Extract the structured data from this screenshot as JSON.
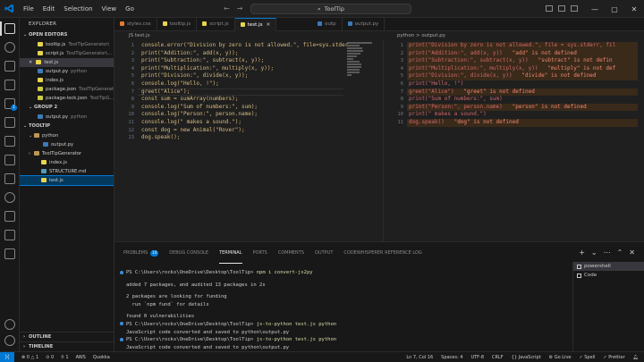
{
  "titlebar": {
    "menu": [
      "File",
      "Edit",
      "Selection",
      "View",
      "Go"
    ],
    "search_text": "ToolTip",
    "colors": {
      "accent": "#0078d4"
    }
  },
  "sidebar": {
    "title": "EXPLORER",
    "open_editors_label": "OPEN EDITORS",
    "open_editors": [
      {
        "name": "tooltip.js",
        "path": "ToolTipGenerator\\",
        "icon": "js"
      },
      {
        "name": "script.js",
        "path": "ToolTipGenerator\\...",
        "icon": "js"
      },
      {
        "name": "test.js",
        "path": "",
        "icon": "js",
        "close": "✕"
      },
      {
        "name": "output.py",
        "path": "python",
        "icon": "py"
      },
      {
        "name": "index.js",
        "path": "",
        "icon": "js"
      },
      {
        "name": "package.json",
        "path": "ToolTipGenerat...",
        "icon": "json"
      },
      {
        "name": "package-lock.json",
        "path": "ToolTipG...",
        "icon": "json"
      }
    ],
    "group2_label": "GROUP 2",
    "group2_items": [
      {
        "name": "output.py",
        "path": "python",
        "icon": "py"
      }
    ],
    "folder_label": "TOOLTIP",
    "tree": [
      {
        "name": "python",
        "icon": "folder",
        "chev": "⌄",
        "indent": 10
      },
      {
        "name": "output.py",
        "icon": "py",
        "chev": "",
        "indent": 20
      },
      {
        "name": "ToolTipGenerator",
        "icon": "folder",
        "chev": "›",
        "indent": 10
      },
      {
        "name": "index.js",
        "icon": "js",
        "chev": "",
        "indent": 18
      },
      {
        "name": "STRUCTURE.md",
        "icon": "md",
        "chev": "",
        "indent": 18
      },
      {
        "name": "test.js",
        "icon": "js",
        "chev": "",
        "indent": 18
      }
    ],
    "outline_label": "OUTLINE",
    "timeline_label": "TIMELINE"
  },
  "tabs": [
    {
      "name": "styles.css",
      "icon": "html"
    },
    {
      "name": "tooltip.js",
      "icon": "js"
    },
    {
      "name": "script.js",
      "icon": "js"
    },
    {
      "name": "test.js",
      "icon": "js",
      "active": true,
      "close": "✕"
    },
    {
      "name": "outp",
      "icon": "py"
    },
    {
      "name": "output.py",
      "icon": "py"
    }
  ],
  "left_editor": {
    "breadcrumb": "JS test.js",
    "lines": [
      "console.error(\"Division by zero is not allowed.\", file=sys.stder",
      "print(\"Addition:\", add(x, y));",
      "print(\"Subtraction:\", subtract(x, y));",
      "print(\"Multiplication:\", multiply(x, y));",
      "print(\"Division:\", divide(x, y));",
      "console.log(\"Hello, !\");",
      "greet(\"Alice\");",
      "const sum = sumArray(numbers);",
      "console.log(\"Sum of numbers:\", sum);",
      "console.log(\"Person:\", person.name);",
      "console.log(\" makes a sound.\");",
      "const dog = new Animal(\"Rover\");",
      "dog.speak();"
    ]
  },
  "right_editor": {
    "breadcrumb": "python > output.py",
    "lines": [
      {
        "code": "print(\"Division by zero is not allowed.\", file = sys.stderr, fil",
        "err": ""
      },
      {
        "code": "print(\"Addition:\", add(x, y))",
        "err": "   \"add\" is not defined"
      },
      {
        "code": "print(\"Subtraction:\", subtract(x, y))",
        "err": "   \"subtract\" is not defin"
      },
      {
        "code": "print(\"Multiplication:\", multiply(x, y))",
        "err": "   \"multiply\" is not def"
      },
      {
        "code": "print(\"Division:\", divide(x, y))",
        "err": "   \"divide\" is not defined"
      },
      {
        "code": "print(\"Hello, !\")",
        "err": ""
      },
      {
        "code": "greet(\"Alice\")",
        "err": "   \"greet\" is not defined"
      },
      {
        "code": "print(\"Sum of numbers:\", sum)",
        "err": ""
      },
      {
        "code": "print(\"Person:\", person.name)",
        "err": "   \"person\" is not defined"
      },
      {
        "code": "print(\" makes a sound.\")",
        "err": ""
      },
      {
        "code": "dog.speak()",
        "err": "   \"dog\" is not defined"
      }
    ]
  },
  "panel": {
    "tabs": [
      "PROBLEMS",
      "DEBUG CONSOLE",
      "TERMINAL",
      "PORTS",
      "COMMENTS",
      "OUTPUT",
      "CODEWHISPERER REFERENCE LOG"
    ],
    "problems_count": "10",
    "active_tab": "TERMINAL",
    "actions": [
      "+",
      "⌄",
      "⋯",
      "⌃",
      "✕"
    ],
    "terminal_lines": [
      {
        "prompt": "PS C:\\Users\\rocks\\OneDrive\\Desktop\\ToolTip> ",
        "cmd": "npm i convert-js2py",
        "marker": "#3c8dde"
      },
      {
        "text": ""
      },
      {
        "text": "added 7 packages, and audited 13 packages in 2s"
      },
      {
        "text": ""
      },
      {
        "text": "2 packages are looking for funding"
      },
      {
        "text": "  run `npm fund` for details"
      },
      {
        "text": ""
      },
      {
        "text": "found 0 vulnerabilities"
      },
      {
        "prompt": "PS C:\\Users\\rocks\\OneDrive\\Desktop\\ToolTip> ",
        "cmd": "js-to-python test.js python",
        "marker": "#3c8dde"
      },
      {
        "text": "JavaScript code converted and saved to python\\output.py"
      },
      {
        "prompt": "PS C:\\Users\\rocks\\OneDrive\\Desktop\\ToolTip> ",
        "cmd": "js-to-python test.js python",
        "marker": "#3c8dde"
      },
      {
        "text": "JavaScript code converted and saved to python\\output.py"
      }
    ],
    "terminals": [
      "powershell",
      "Code"
    ]
  },
  "statusbar": {
    "left": [
      "⊗ 0 △ 1",
      "⊙ 0",
      "⚲ 1",
      "AWS",
      "Quokka"
    ],
    "right": [
      "Ln 7, Col 16",
      "Spaces: 4",
      "UTF-8",
      "CRLF",
      "{} JavaScript",
      "⚙ Go Live",
      "✓ Spell",
      "✓ Prettier"
    ]
  }
}
